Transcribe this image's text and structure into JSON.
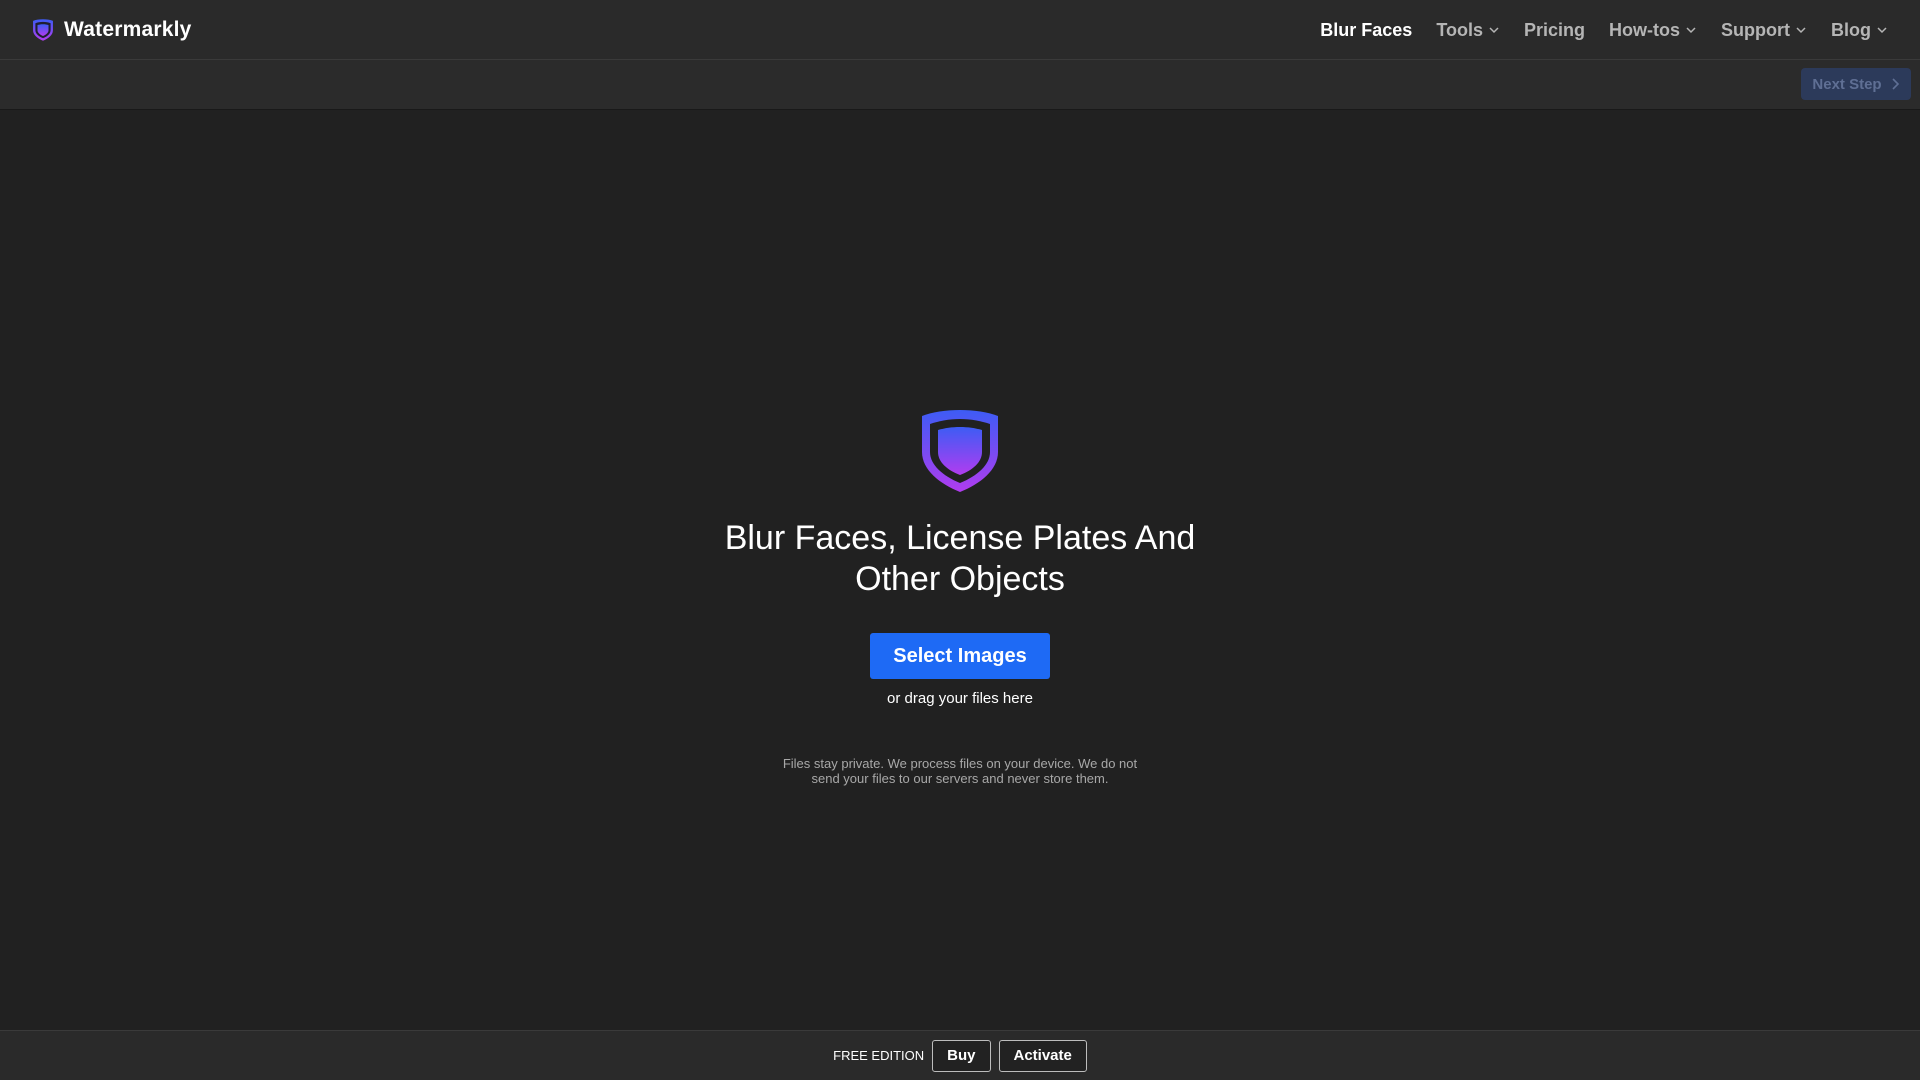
{
  "header": {
    "brand_name": "Watermarkly",
    "brand_logo_icon": "shield-icon",
    "nav": [
      {
        "label": "Blur Faces",
        "dropdown": false,
        "active": true
      },
      {
        "label": "Tools",
        "dropdown": true,
        "active": false
      },
      {
        "label": "Pricing",
        "dropdown": false,
        "active": false
      },
      {
        "label": "How-tos",
        "dropdown": true,
        "active": false
      },
      {
        "label": "Support",
        "dropdown": true,
        "active": false
      },
      {
        "label": "Blog",
        "dropdown": true,
        "active": false
      }
    ]
  },
  "toolbar": {
    "next_step_label": "Next Step",
    "next_step_icon": "chevron-right-icon",
    "next_step_enabled": false
  },
  "hero": {
    "icon": "shield-icon",
    "title_line1": "Blur Faces, License Plates And",
    "title_line2": "Other Objects",
    "select_button_label": "Select Images",
    "drag_text": "or drag your files here",
    "privacy_line1": "Files stay private. We process files on your device. We do not",
    "privacy_line2": "send your files to our servers and never store them."
  },
  "footer": {
    "edition_label": "FREE EDITION",
    "buy_label": "Buy",
    "activate_label": "Activate"
  },
  "colors": {
    "background": "#212121",
    "header_background": "#2a2a2a",
    "primary_button": "#1e6af5",
    "shield_gradient_top": "#3d5cf5",
    "shield_gradient_bottom": "#b13cf0",
    "next_step_disabled_bg": "#2c3a5a"
  }
}
